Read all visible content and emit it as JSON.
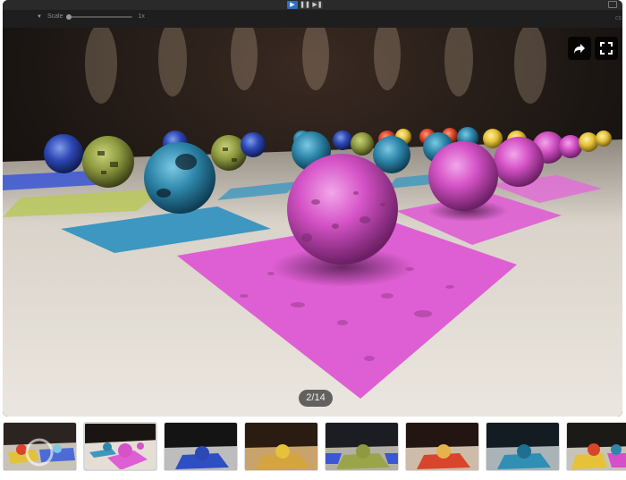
{
  "toolbar": {
    "scale_label": "Scale",
    "scale_value": "1x",
    "truncated_right": "cs"
  },
  "controls": {
    "play_icon": "play-icon",
    "pause_icon": "pause-icon",
    "step_icon": "step-icon"
  },
  "viewer": {
    "slide_counter": "2/14",
    "share_icon": "share-icon",
    "fullscreen_icon": "fullscreen-icon"
  },
  "thumbnails": [
    {
      "label": "thumbnail 1",
      "theme": "colorful"
    },
    {
      "label": "thumbnail 2",
      "theme": "pink-spheres"
    },
    {
      "label": "thumbnail 3",
      "theme": "blue"
    },
    {
      "label": "thumbnail 4",
      "theme": "amber"
    },
    {
      "label": "thumbnail 5",
      "theme": "olive"
    },
    {
      "label": "thumbnail 6",
      "theme": "red"
    },
    {
      "label": "thumbnail 7",
      "theme": "teal"
    },
    {
      "label": "thumbnail 8",
      "theme": "multicolor"
    }
  ],
  "colors": {
    "accent": "#2d6fc0",
    "pink": "#d64fc8",
    "teal": "#2f8fb5",
    "olive": "#8f9a3f",
    "floor": "#e9e3da"
  }
}
